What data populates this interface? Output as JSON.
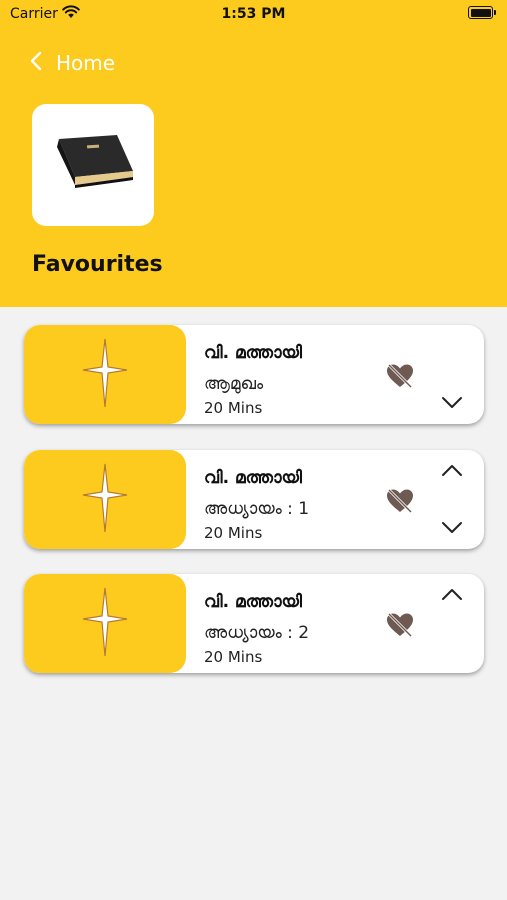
{
  "status_bar": {
    "carrier": "Carrier",
    "time": "1:53 PM"
  },
  "nav": {
    "back_label": "Home"
  },
  "page": {
    "title": "Favourites"
  },
  "colors": {
    "accent": "#fdca1e",
    "icon": "#6e5a52",
    "background": "#f2f2f2"
  },
  "favourites": [
    {
      "title": "വി. മത്തായി",
      "chapter": "ആമുഖം",
      "duration": "20 Mins",
      "has_up": false,
      "has_down": true
    },
    {
      "title": "വി. മത്തായി",
      "chapter": "അധ്യായം : 1",
      "duration": "20 Mins",
      "has_up": true,
      "has_down": true
    },
    {
      "title": "വി. മത്തായി",
      "chapter": "അധ്യായം : 2",
      "duration": "20 Mins",
      "has_up": true,
      "has_down": false
    }
  ],
  "icons": {
    "back": "chevron-left-icon",
    "book": "bible-book-icon",
    "thumb": "cross-icon",
    "favourite": "heart-slash-icon",
    "up": "chevron-up-icon",
    "down": "chevron-down-icon"
  }
}
